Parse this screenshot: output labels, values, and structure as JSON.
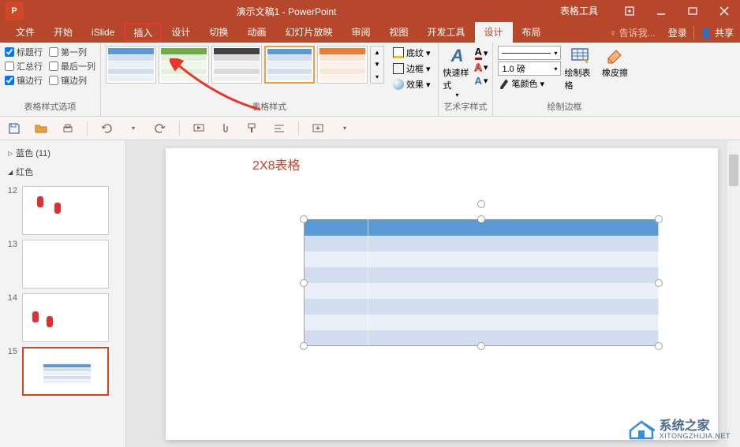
{
  "titlebar": {
    "title": "演示文稿1 - PowerPoint",
    "context_tab": "表格工具"
  },
  "ribbon_tabs": {
    "items": [
      "文件",
      "开始",
      "iSlide",
      "插入",
      "设计",
      "切换",
      "动画",
      "幻灯片放映",
      "审阅",
      "视图",
      "开发工具",
      "设计",
      "布局"
    ],
    "highlighted_index": 3,
    "active_index": 11,
    "tell_me": "告诉我...",
    "login": "登录",
    "share": "共享"
  },
  "ribbon": {
    "style_options": {
      "label": "表格样式选项",
      "header_row": "标题行",
      "first_col": "第一列",
      "total_row": "汇总行",
      "last_col": "最后一列",
      "banded_rows": "镶边行",
      "banded_cols": "镶边列",
      "checked": {
        "header_row": true,
        "first_col": false,
        "total_row": false,
        "last_col": false,
        "banded_rows": true,
        "banded_cols": false
      }
    },
    "table_styles": {
      "label": "表格样式",
      "shading": "底纹",
      "borders": "边框",
      "effects": "效果"
    },
    "wordart": {
      "label": "艺术字样式",
      "quick": "快速样式"
    },
    "borders": {
      "label": "绘制边框",
      "pen_weight": "1.0 磅",
      "pen_color": "笔颜色",
      "draw_table": "绘制表格",
      "eraser": "橡皮擦"
    }
  },
  "nav": {
    "section_blue": "蓝色 (11)",
    "section_red": "红色",
    "slides": [
      {
        "num": "12"
      },
      {
        "num": "13"
      },
      {
        "num": "14"
      },
      {
        "num": "15"
      }
    ]
  },
  "slide": {
    "annotation": "2X8表格"
  },
  "watermark": {
    "main": "系统之家",
    "sub": "XITONGZHIJIA.NET"
  }
}
